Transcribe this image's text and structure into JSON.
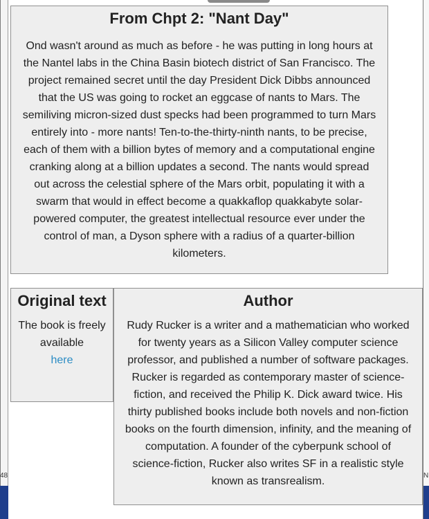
{
  "excerpt": {
    "title": "From Chpt 2: \"Nant Day\"",
    "body": "Ond wasn't around as much as before - he was putting in long hours at the Nantel labs in the China Basin biotech district of San Francisco. The project remained secret until the day President Dick Dibbs announced that the US was going to rocket an eggcase of nants to Mars. The semiliving micron-sized dust specks had been programmed to turn Mars entirely into - more nants! Ten-to-the-thirty-ninth nants, to be precise, each of them with a billion bytes of memory and a computational engine cranking along at a billion updates a second. The nants would spread out across the celestial sphere of the Mars orbit, populating it with a swarm that would in effect become a quakkaflop quakkabyte solar-powered computer, the greatest intellectual resource ever under the control of man, a Dyson sphere with a radius of a quarter-billion kilometers."
  },
  "original": {
    "title": "Original text",
    "body": "The book is freely available",
    "link_label": "here",
    "link_color": "#2b8cc4"
  },
  "author": {
    "title": "Author",
    "body": "Rudy Rucker is a writer and a mathematician who worked for twenty years as a Silicon Valley computer science professor, and published a number of software packages. Rucker is regarded as contemporary master of science-fiction, and received the Philip K. Dick award twice. His thirty published books include both novels and non-fiction books on the fourth dimension, infinity, and the meaning of computation. A founder of the cyberpunk school of science-fiction, Rucker also writes SF in a realistic style known as transrealism."
  },
  "edge": {
    "left_number": "48",
    "right_number": "N"
  },
  "colors": {
    "panel_bg": "#eeeeee",
    "panel_border": "#8f8f8f",
    "text": "#222222",
    "taskbar": "#1f3e8c"
  }
}
